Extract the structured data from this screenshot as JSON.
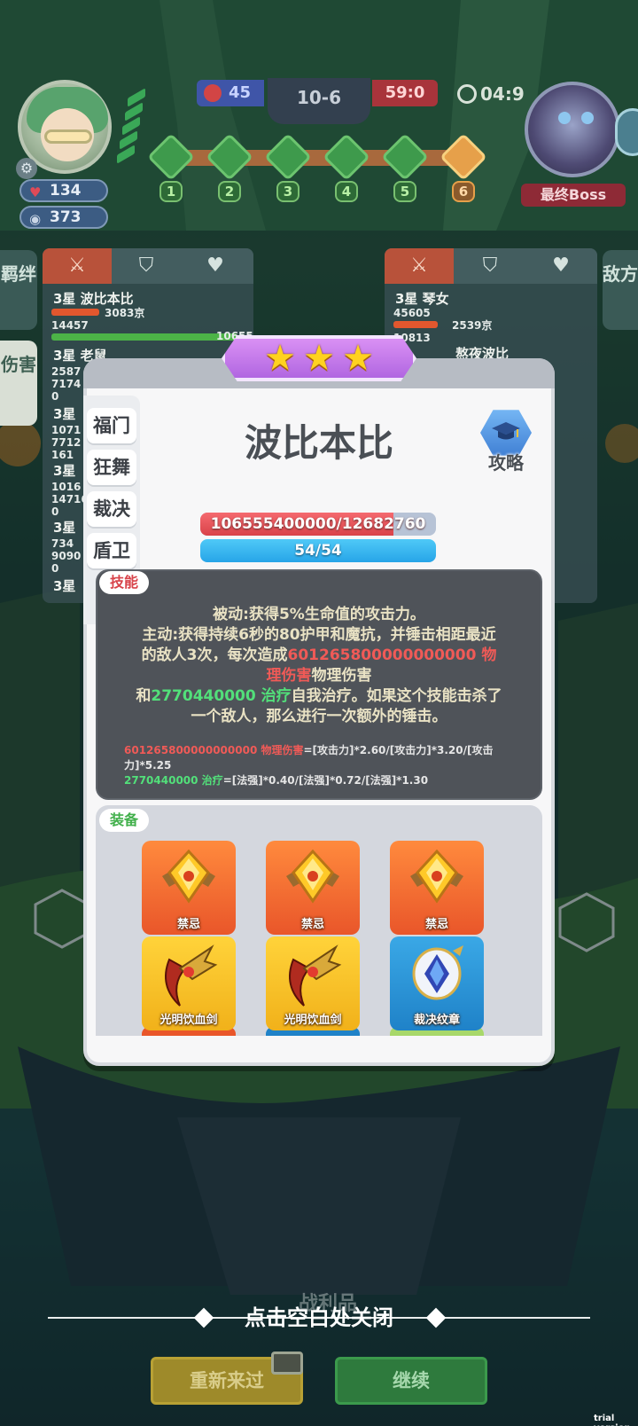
{
  "hud": {
    "player_hp": "134",
    "player_coins": "373",
    "left_score": "45",
    "stage": "10-6",
    "right_score": "59:0",
    "timer": "04:9",
    "boss_label": "最终Boss",
    "waves": [
      "1",
      "2",
      "3",
      "4",
      "5",
      "6"
    ]
  },
  "side_tabs": {
    "left": [
      "羁绊",
      "伤害"
    ],
    "right": [
      "敌方"
    ]
  },
  "left_panel": {
    "rows": [
      {
        "name": "3星 波比本比",
        "num1": "3083京",
        "num2": "14457",
        "num3": "10655"
      },
      {
        "name": "3星 老鼠",
        "num1": "2587",
        "num2": "7174",
        "num3": "0"
      },
      {
        "name": "3星",
        "num1": "1071",
        "num2": "7712",
        "num3": "161"
      },
      {
        "name": "3星",
        "num1": "1016",
        "num2": "14716",
        "num3": "0"
      },
      {
        "name": "3星",
        "num1": "734",
        "num2": "9090",
        "num3": "0"
      },
      {
        "name": "3星"
      }
    ]
  },
  "right_panel": {
    "rows": [
      {
        "name": "3星 琴女",
        "num1": "45605",
        "num2": "2539京",
        "num3": "10813"
      },
      {
        "name": "熬夜波比"
      }
    ]
  },
  "popup": {
    "stars": 3,
    "tabs": [
      "福门",
      "狂舞",
      "裁决",
      "盾卫"
    ],
    "hero_name": "波比本比",
    "guide_label": "攻略",
    "hp_text": "106555400000/12682760",
    "hp_fraction": 0.82,
    "mp_text": "54/54",
    "skill_tag": "技能",
    "skill": {
      "line1": "被动:获得5%生命值的攻击力。",
      "line2": "主动:获得持续6秒的80护甲和魔抗，并锤击相距最近",
      "line3a": "的敌人3次，每次造成",
      "line3b": "601265800000000000 物",
      "line4a": "理伤害",
      "line4b": "物理伤害",
      "line5a": "和",
      "line5b": "2770440000 治疗",
      "line5c": "自我治疗。如果这个技能击杀了",
      "line6": "一个敌人，那么进行一次额外的锤击。"
    },
    "formula": {
      "red_value": "601265800000000000 物理伤害",
      "red_expr": "=[攻击力]*2.60/[攻击力]*3.20/[攻击力]*5.25",
      "green_value": "2770440000 治疗",
      "green_expr": "=[法强]*0.40/[法强]*0.72/[法强]*1.30"
    },
    "equip_tag": "装备",
    "items": [
      {
        "name": "禁忌",
        "color": "orange",
        "icon": "forbidden-gem-icon"
      },
      {
        "name": "禁忌",
        "color": "orange",
        "icon": "forbidden-gem-icon"
      },
      {
        "name": "禁忌",
        "color": "orange",
        "icon": "forbidden-gem-icon"
      },
      {
        "name": "光明饮血剑",
        "color": "yellow",
        "icon": "bloodthirster-icon"
      },
      {
        "name": "光明饮血剑",
        "color": "yellow",
        "icon": "bloodthirster-icon"
      },
      {
        "name": "裁决纹章",
        "color": "blue",
        "icon": "emblem-icon"
      }
    ]
  },
  "bottom": {
    "close_hint": "点击空白处关闭",
    "loot_label": "战利品",
    "retry_label": "重新来过",
    "continue_label": "继续"
  },
  "watermark": "trial version"
}
